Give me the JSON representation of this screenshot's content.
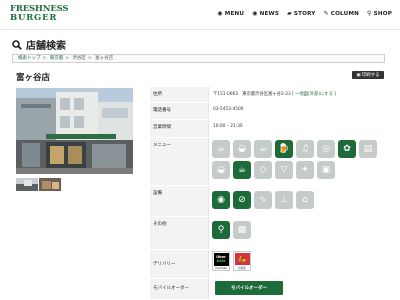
{
  "header": {
    "logo_line1": "FRESHNESS",
    "logo_line2": "BURGER",
    "nav": [
      {
        "icon": "menu-icon",
        "label": "MENU"
      },
      {
        "icon": "news-icon",
        "label": "NEWS"
      },
      {
        "icon": "story-icon",
        "label": "STORY"
      },
      {
        "icon": "column-icon",
        "label": "COLUMN"
      },
      {
        "icon": "shop-pin-icon",
        "label": "SHOP"
      }
    ]
  },
  "page_title": "店舗検索",
  "breadcrumb": [
    "検索トップ",
    "東京都",
    "渋谷区",
    "富ヶ谷店"
  ],
  "store_name": "富ヶ谷店",
  "print_label": "印刷する",
  "info": {
    "address_label": "住所",
    "address_value": "〒151-0063　東京都渋谷区富ヶ谷2-23",
    "map_link": "[ 一地図(外部)にする ]",
    "phone_label": "電話番号",
    "phone_value": "03-5453-4500",
    "hours_label": "営業時間",
    "hours_value": "10:00 – 21:30",
    "menu_label": "メニュー",
    "facilities_label": "設備",
    "other_label": "その他",
    "delivery_label": "デリバリー",
    "mobile_label": "モバイルオーダー",
    "mobile_button": "モバイルオーダー",
    "uber_line1": "Uber",
    "uber_line2": "Eats",
    "uber_caption": "UberEats",
    "menu_caption": "出前館"
  },
  "menu_icons": [
    {
      "name": "morning-icon",
      "on": false,
      "glyph": "☕"
    },
    {
      "name": "burger-icon",
      "on": false,
      "glyph": "◒"
    },
    {
      "name": "takeout-icon",
      "on": false,
      "glyph": "☕"
    },
    {
      "name": "beer-icon",
      "on": true,
      "glyph": "🍺"
    },
    {
      "name": "alcohol-icon",
      "on": false,
      "glyph": "♫"
    },
    {
      "name": "kids-icon",
      "on": false,
      "glyph": "◎"
    },
    {
      "name": "salad-icon",
      "on": true,
      "glyph": "✿"
    },
    {
      "name": "card-icon",
      "on": false,
      "glyph": "▤"
    },
    {
      "name": "sandwich-icon",
      "on": false,
      "glyph": "◒"
    },
    {
      "name": "coffee-cup-icon",
      "on": true,
      "glyph": "☕"
    },
    {
      "name": "dessert-icon",
      "on": false,
      "glyph": "◇"
    },
    {
      "name": "softcream-icon",
      "on": false,
      "glyph": "▽"
    },
    {
      "name": "veggie-icon",
      "on": false,
      "glyph": "✦"
    },
    {
      "name": "coupon-icon",
      "on": false,
      "glyph": "▣"
    }
  ],
  "facility_icons": [
    {
      "name": "wifi-icon",
      "on": true,
      "glyph": "◉"
    },
    {
      "name": "no-smoking-icon",
      "on": true,
      "glyph": "⊘"
    },
    {
      "name": "smoking-icon",
      "on": false,
      "glyph": "∿"
    },
    {
      "name": "power-outlet-icon",
      "on": false,
      "glyph": "⊥"
    },
    {
      "name": "terrace-icon",
      "on": false,
      "glyph": "⌂"
    }
  ],
  "other_icons": [
    {
      "name": "recruit-icon",
      "on": true,
      "glyph": "⚲"
    },
    {
      "name": "parking-icon",
      "on": false,
      "glyph": "▦"
    }
  ]
}
